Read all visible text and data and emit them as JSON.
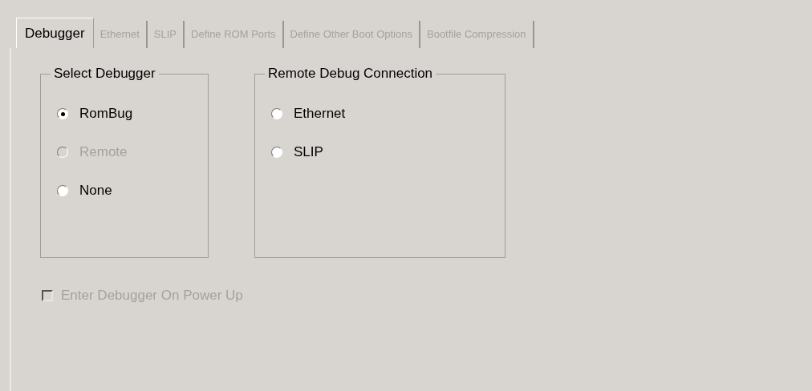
{
  "tabs": [
    {
      "label": "Debugger",
      "selected": true,
      "disabled": false
    },
    {
      "label": "Ethernet",
      "selected": false,
      "disabled": true
    },
    {
      "label": "SLIP",
      "selected": false,
      "disabled": true
    },
    {
      "label": "Define ROM Ports",
      "selected": false,
      "disabled": true
    },
    {
      "label": "Define Other Boot Options",
      "selected": false,
      "disabled": true
    },
    {
      "label": "Bootfile Compression",
      "selected": false,
      "disabled": true
    }
  ],
  "groups": [
    {
      "title": "Select Debugger",
      "options": [
        {
          "label": "RomBug",
          "selected": true,
          "disabled": false
        },
        {
          "label": "Remote",
          "selected": false,
          "disabled": true
        },
        {
          "label": "None",
          "selected": false,
          "disabled": false
        }
      ]
    },
    {
      "title": "Remote Debug Connection",
      "options": [
        {
          "label": "Ethernet",
          "selected": false,
          "disabled": false
        },
        {
          "label": "SLIP",
          "selected": false,
          "disabled": false
        }
      ]
    }
  ],
  "checkbox": {
    "label": "Enter Debugger On Power Up",
    "checked": false,
    "disabled": true
  }
}
